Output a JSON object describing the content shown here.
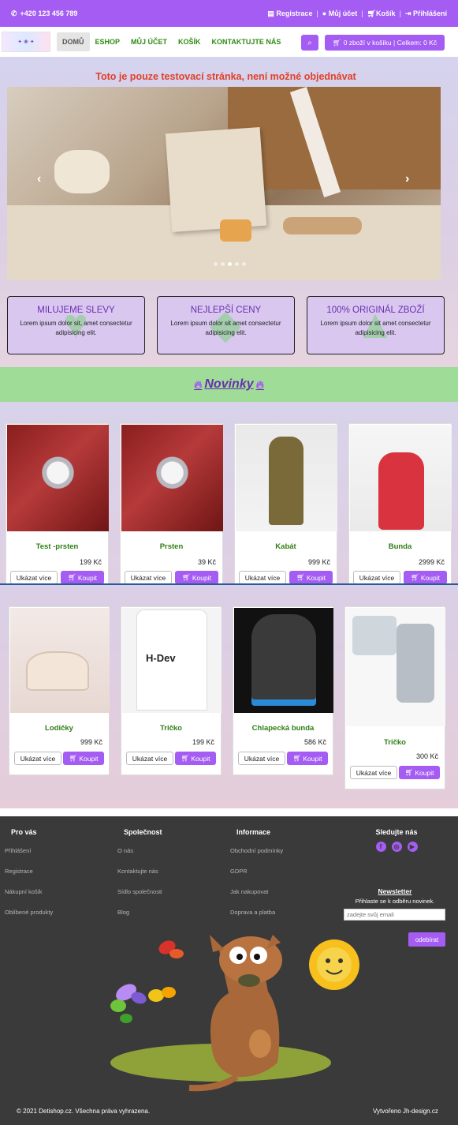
{
  "topbar": {
    "phone": "+420 123 456 789",
    "links": [
      {
        "label": "Registrace",
        "icon": "clipboard-icon"
      },
      {
        "label": "Můj účet",
        "icon": "user-icon"
      },
      {
        "label": "Košík",
        "icon": "cart-icon"
      },
      {
        "label": "Přihlášení",
        "icon": "login-icon"
      }
    ]
  },
  "nav": {
    "items": [
      "DOMŮ",
      "ESHOP",
      "MŮJ ÚČET",
      "KOŠÍK",
      "KONTAKTUJTE NÁS"
    ],
    "cart_summary": "0 zboží v košíku | Celkem: 0 Kč"
  },
  "hero": {
    "notice": "Toto je pouze testovací stránka, není možné objednávat",
    "slide_count": 5,
    "active_slide": 2
  },
  "features": [
    {
      "title": "MILUJEME SLEVY",
      "text": "Lorem ipsum dolor sit, amet consectetur adipisicing elit.",
      "icon": "heart-icon"
    },
    {
      "title": "NEJLEPŠÍ CENY",
      "text": "Lorem ipsum dolor sit amet consectetur adipisicing elit.",
      "icon": "tag-icon"
    },
    {
      "title": "100% ORIGINÁL ZBOŽÍ",
      "text": "Lorem ipsum dolor sit amet consectetur adipisicing elit.",
      "icon": "thumbs-up-icon"
    }
  ],
  "novinky": {
    "title": "Novinky"
  },
  "products_row1": [
    {
      "name": "Test -prsten",
      "price": "199 Kč"
    },
    {
      "name": "Prsten",
      "price": "39 Kč"
    },
    {
      "name": "Kabát",
      "price": "999 Kč"
    },
    {
      "name": "Bunda",
      "price": "2999 Kč"
    }
  ],
  "products_row2": [
    {
      "name": "Lodičky",
      "price": "999 Kč"
    },
    {
      "name": "Tričko",
      "price": "199 Kč"
    },
    {
      "name": "Chlapecká bunda",
      "price": "586 Kč"
    },
    {
      "name": "Tričko",
      "price": "300 Kč"
    }
  ],
  "product_buttons": {
    "more": "Ukázat více",
    "buy": "Koupit"
  },
  "footer": {
    "col1": {
      "title": "Pro vás",
      "links": [
        "Přihlášení",
        "Registrace",
        "Nákupní košík",
        "Oblíbené produkty"
      ]
    },
    "col2": {
      "title": "Společnost",
      "links": [
        "O nás",
        "Kontaktujte nás",
        "Sídlo společnosti",
        "Blog"
      ]
    },
    "col3": {
      "title": "Informace",
      "links": [
        "Obchodní podmínky",
        "GDPR",
        "Jak nakupovat",
        "Doprava a platba"
      ]
    },
    "social": {
      "title": "Sledujte nás",
      "icons": [
        "facebook-icon",
        "instagram-icon",
        "youtube-icon"
      ]
    },
    "newsletter": {
      "title": "Newsletter",
      "text": "Přihlaste se k odběru novinek.",
      "placeholder": "zadejte svůj email",
      "button": "odebírat"
    },
    "copyright": "© 2021 Detishop.cz. Všechna práva vyhrazena.",
    "credit": "Vytvořeno Jh-design.cz"
  },
  "colors": {
    "accent": "#a45cf2",
    "nav_text": "#2e8b12",
    "notice": "#e0402a",
    "novinky_band": "#9edc98",
    "footer_bg": "#3a3a3a"
  }
}
